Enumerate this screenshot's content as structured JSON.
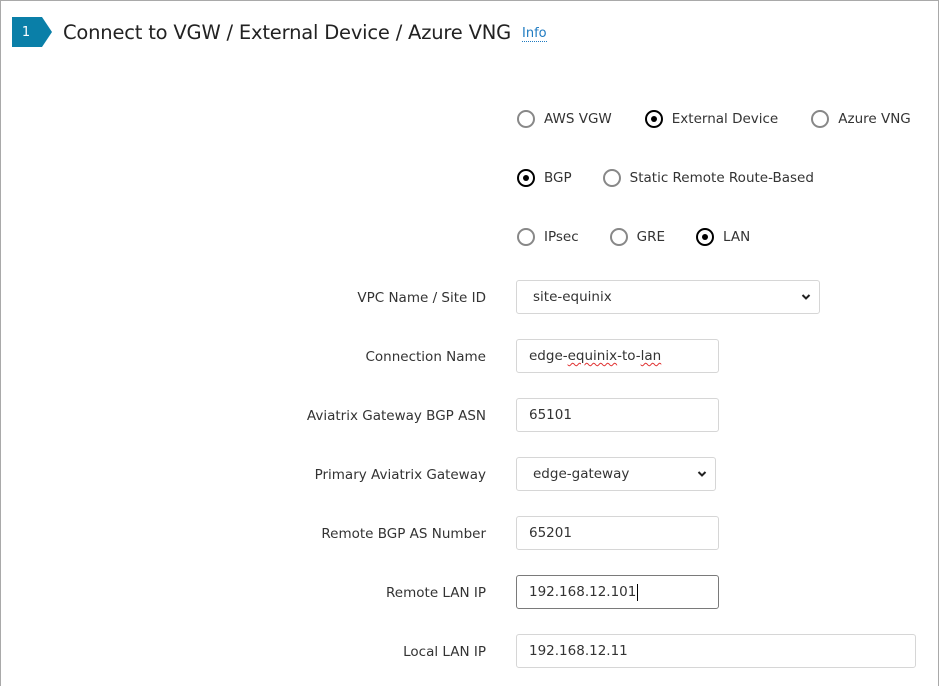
{
  "header": {
    "step_number": "1",
    "title": "Connect to VGW / External Device / Azure VNG",
    "info_label": "Info"
  },
  "colors": {
    "accent": "#0a7fa8",
    "link": "#1f7bc1"
  },
  "radio_groups": {
    "target_type": {
      "options": [
        "AWS VGW",
        "External Device",
        "Azure VNG"
      ],
      "selected": "External Device"
    },
    "routing": {
      "options": [
        "BGP",
        "Static Remote Route-Based"
      ],
      "selected": "BGP"
    },
    "tunnel_type": {
      "options": [
        "IPsec",
        "GRE",
        "LAN"
      ],
      "selected": "LAN"
    }
  },
  "form": {
    "vpc_name": {
      "label": "VPC Name / Site ID",
      "value": "site-equinix"
    },
    "connection_name": {
      "label": "Connection Name",
      "value_parts": [
        "edge-",
        "equinix",
        "-to-",
        "lan"
      ]
    },
    "gateway_bgp_asn": {
      "label": "Aviatrix Gateway BGP ASN",
      "value": "65101"
    },
    "primary_gateway": {
      "label": "Primary Aviatrix Gateway",
      "value": "edge-gateway"
    },
    "remote_bgp_as": {
      "label": "Remote BGP AS Number",
      "value": "65201"
    },
    "remote_lan_ip": {
      "label": "Remote LAN IP",
      "value": "192.168.12.101"
    },
    "local_lan_ip": {
      "label": "Local LAN IP",
      "value": "192.168.12.11"
    }
  }
}
